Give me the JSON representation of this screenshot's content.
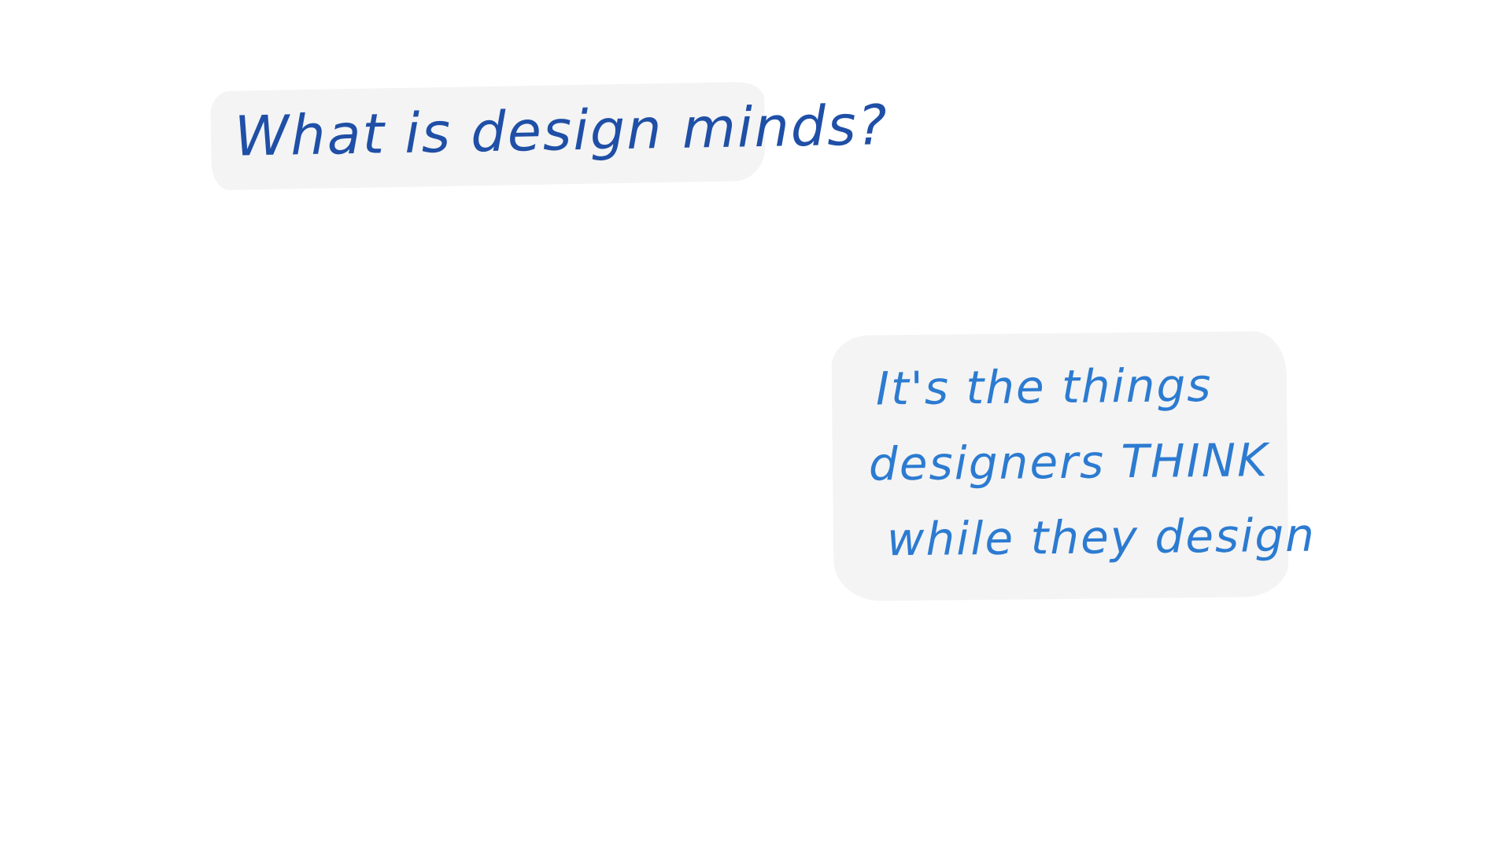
{
  "question": {
    "text": "What is design minds?"
  },
  "answer": {
    "lines": [
      "It's the things",
      "designers THINK",
      "while they design"
    ]
  },
  "colors": {
    "question_ink": "#1f4fa6",
    "answer_ink": "#2c7bd1",
    "note_background": "#f4f4f4",
    "page_background": "#ffffff"
  }
}
